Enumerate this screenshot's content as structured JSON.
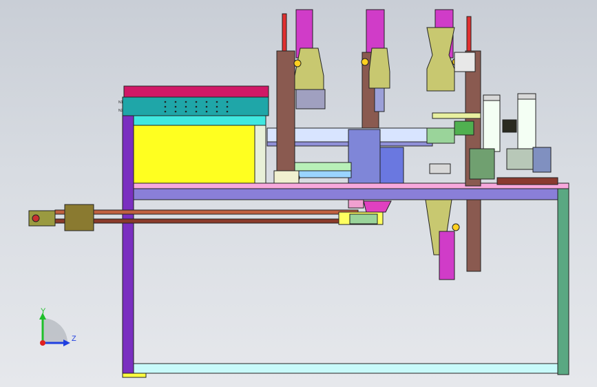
{
  "view": {
    "background_top": "#c9ced6",
    "background_bottom": "#e6e8ec"
  },
  "triad": {
    "y_label": "Y",
    "z_label": "Z",
    "y_color": "#1fbf2a",
    "z_color": "#1f3fe0",
    "origin_color": "#e02020"
  },
  "colors": {
    "frame_purple": "#7a2fc0",
    "frame_lavender": "#8a7fd8",
    "frame_cyan": "#c8fafa",
    "frame_green": "#5aa882",
    "table_pink": "#f7a8dc",
    "yellow_box": "#ffff20",
    "teal_box": "#1fa6a8",
    "magenta": "#d01896",
    "horn_olive": "#c8c870",
    "brown_column": "#8a5a50",
    "slate_blue": "#7f86d8"
  },
  "parts": {
    "tool_box_left_tag_top": "N1",
    "tool_box_left_tag_bottom": "N2"
  }
}
